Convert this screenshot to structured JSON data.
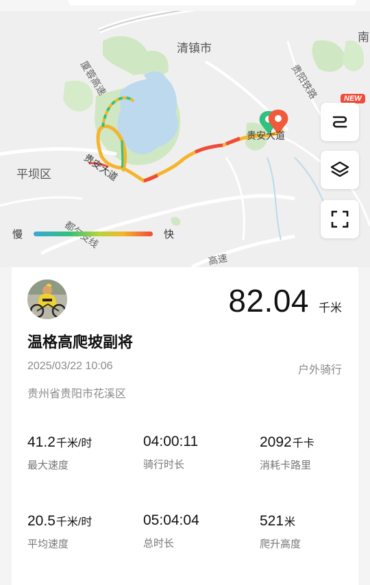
{
  "map": {
    "labels": {
      "qingzhen": "清镇市",
      "pingba": "平坝区",
      "nan": "南",
      "xiamang": "厦蓉高速",
      "guian_avenue_west": "贵安大道",
      "guian_avenue_east": "贵安大道",
      "gui_branch": "都匀支线",
      "gaosu_bottom": "高速",
      "gui_rail": "贵阳铁路"
    },
    "badge_new": "NEW",
    "legend": {
      "slow": "慢",
      "fast": "快"
    },
    "icons": {
      "route": "route-icon",
      "layers": "layers-icon",
      "fullscreen": "fullscreen-icon"
    }
  },
  "activity": {
    "distance_value": "82.04",
    "distance_unit": "千米",
    "title": "温格高爬坡副将",
    "date": "2025/03/22 10:06",
    "type": "户外骑行",
    "location": "贵州省贵阳市花溪区"
  },
  "stats": [
    {
      "value": "41.2",
      "unit": "千米/时",
      "label": "最大速度"
    },
    {
      "value": "04:00:11",
      "unit": "",
      "label": "骑行时长"
    },
    {
      "value": "2092",
      "unit": "千卡",
      "label": "消耗卡路里"
    },
    {
      "value": "20.5",
      "unit": "千米/时",
      "label": "平均速度"
    },
    {
      "value": "05:04:04",
      "unit": "",
      "label": "总时长"
    },
    {
      "value": "521",
      "unit": "米",
      "label": "爬升高度"
    }
  ],
  "colors": {
    "route_slow": "#3aa7d8",
    "route_mid": "#f4b52c",
    "route_fast": "#ef4a3c",
    "start_pin": "#2ec27e",
    "end_pin": "#ef5a3c"
  }
}
